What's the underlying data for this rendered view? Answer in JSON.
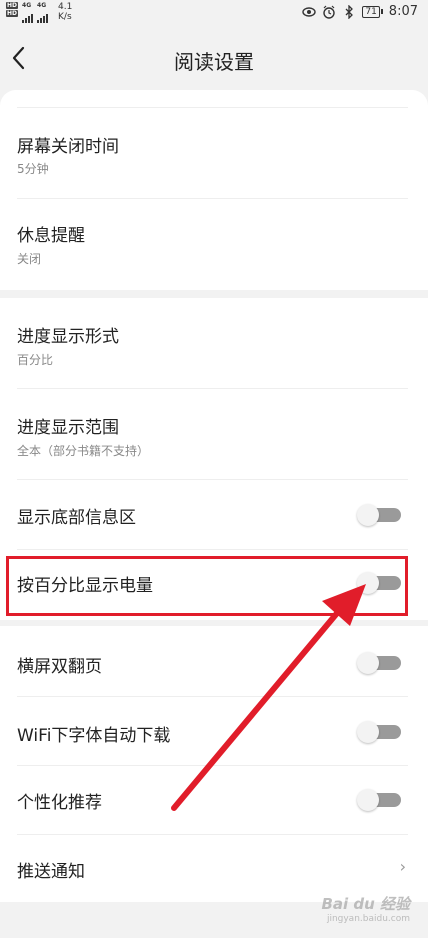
{
  "status_bar": {
    "hd_labels": [
      "HD",
      "HD"
    ],
    "net_type": "4G",
    "net_type_2": "4G",
    "speed_value": "4.1",
    "speed_unit": "K/s",
    "battery": "71",
    "time": "8:07"
  },
  "header": {
    "title": "阅读设置"
  },
  "group1": [
    {
      "title": "屏幕关闭时间",
      "subtitle": "5分钟"
    },
    {
      "title": "休息提醒",
      "subtitle": "关闭"
    }
  ],
  "group2": [
    {
      "title": "进度显示形式",
      "subtitle": "百分比"
    },
    {
      "title": "进度显示范围",
      "subtitle": "全本（部分书籍不支持）"
    },
    {
      "title": "显示底部信息区",
      "toggle": false
    },
    {
      "title": "按百分比显示电量",
      "toggle": false
    }
  ],
  "group3": [
    {
      "title": "横屏双翻页",
      "toggle": false
    },
    {
      "title": "WiFi下字体自动下载",
      "toggle": false
    },
    {
      "title": "个性化推荐",
      "toggle": false
    },
    {
      "title": "推送通知",
      "chevron": "›"
    }
  ],
  "annotation_color": "#e11d2a",
  "watermark": {
    "text": "Bai du 经验",
    "url": "jingyan.baidu.com"
  }
}
